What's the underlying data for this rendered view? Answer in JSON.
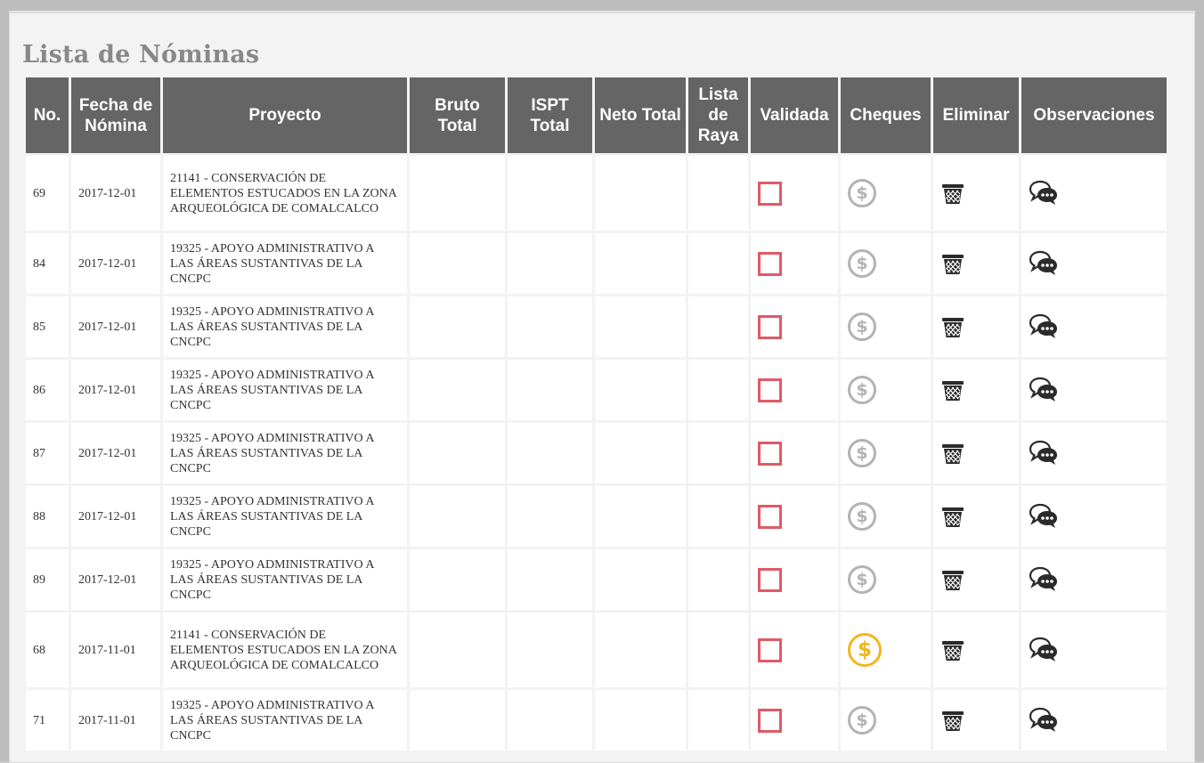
{
  "page": {
    "title": "Lista de Nóminas"
  },
  "colors": {
    "header_bg": "#656565",
    "checkbox_border": "#e05a66",
    "coin_inactive": "#b3b3b3",
    "coin_active": "#f2b51d"
  },
  "table": {
    "headers": {
      "no": "No.",
      "fecha": "Fecha de Nómina",
      "proyecto": "Proyecto",
      "bruto": "Bruto Total",
      "ispt": "ISPT Total",
      "neto": "Neto Total",
      "lista": "Lista de Raya",
      "validada": "Validada",
      "cheques": "Cheques",
      "eliminar": "Eliminar",
      "observaciones": "Observaciones"
    },
    "icons": {
      "validada": "checkbox-unchecked-icon",
      "cheques": "dollar-coin-icon",
      "eliminar": "trash-icon",
      "observaciones": "comments-icon"
    },
    "rows": [
      {
        "no": "69",
        "fecha": "2017-12-01",
        "proyecto": "21141 - CONSERVACIÓN DE ELEMENTOS ESTUCADOS EN LA ZONA ARQUEOLÓGICA DE COMALCALCO",
        "bruto": "",
        "ispt": "",
        "neto": "",
        "lista": "",
        "validada": false,
        "cheque_activo": false
      },
      {
        "no": "84",
        "fecha": "2017-12-01",
        "proyecto": "19325 - APOYO ADMINISTRATIVO A LAS ÁREAS SUSTANTIVAS DE LA CNCPC",
        "bruto": "",
        "ispt": "",
        "neto": "",
        "lista": "",
        "validada": false,
        "cheque_activo": false
      },
      {
        "no": "85",
        "fecha": "2017-12-01",
        "proyecto": "19325 - APOYO ADMINISTRATIVO A LAS ÁREAS SUSTANTIVAS DE LA CNCPC",
        "bruto": "",
        "ispt": "",
        "neto": "",
        "lista": "",
        "validada": false,
        "cheque_activo": false
      },
      {
        "no": "86",
        "fecha": "2017-12-01",
        "proyecto": "19325 - APOYO ADMINISTRATIVO A LAS ÁREAS SUSTANTIVAS DE LA CNCPC",
        "bruto": "",
        "ispt": "",
        "neto": "",
        "lista": "",
        "validada": false,
        "cheque_activo": false
      },
      {
        "no": "87",
        "fecha": "2017-12-01",
        "proyecto": "19325 - APOYO ADMINISTRATIVO A LAS ÁREAS SUSTANTIVAS DE LA CNCPC",
        "bruto": "",
        "ispt": "",
        "neto": "",
        "lista": "",
        "validada": false,
        "cheque_activo": false
      },
      {
        "no": "88",
        "fecha": "2017-12-01",
        "proyecto": "19325 - APOYO ADMINISTRATIVO A LAS ÁREAS SUSTANTIVAS DE LA CNCPC",
        "bruto": "",
        "ispt": "",
        "neto": "",
        "lista": "",
        "validada": false,
        "cheque_activo": false
      },
      {
        "no": "89",
        "fecha": "2017-12-01",
        "proyecto": "19325 - APOYO ADMINISTRATIVO A LAS ÁREAS SUSTANTIVAS DE LA CNCPC",
        "bruto": "",
        "ispt": "",
        "neto": "",
        "lista": "",
        "validada": false,
        "cheque_activo": false
      },
      {
        "no": "68",
        "fecha": "2017-11-01",
        "proyecto": "21141 - CONSERVACIÓN DE ELEMENTOS ESTUCADOS EN LA ZONA ARQUEOLÓGICA DE COMALCALCO",
        "bruto": "",
        "ispt": "",
        "neto": "",
        "lista": "",
        "validada": false,
        "cheque_activo": true
      },
      {
        "no": "71",
        "fecha": "2017-11-01",
        "proyecto": "19325 - APOYO ADMINISTRATIVO A LAS ÁREAS SUSTANTIVAS DE LA CNCPC",
        "bruto": "",
        "ispt": "",
        "neto": "",
        "lista": "",
        "validada": false,
        "cheque_activo": false
      }
    ]
  }
}
